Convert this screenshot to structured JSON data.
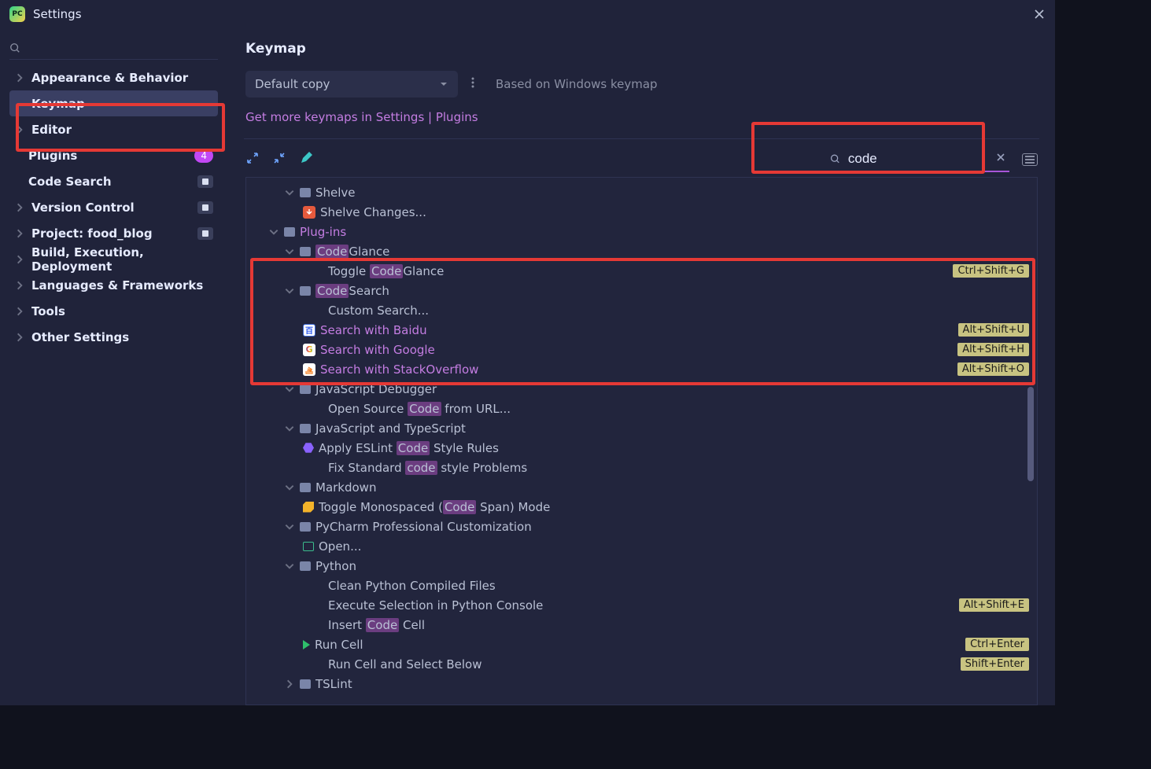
{
  "title": "Settings",
  "crumb": "Keymap",
  "select_value": "Default copy",
  "based_on": "Based on Windows keymap",
  "link_text": "Get more keymaps in Settings | Plugins",
  "search_value": "code",
  "sidebar": [
    {
      "label": "Appearance & Behavior",
      "chev": true
    },
    {
      "label": "Keymap",
      "chev": false,
      "selected": true
    },
    {
      "label": "Editor",
      "chev": true
    },
    {
      "label": "Plugins",
      "chev": false,
      "indent": true,
      "badge": "4"
    },
    {
      "label": "Code Search",
      "chev": false,
      "indent": true,
      "prof": true
    },
    {
      "label": "Version Control",
      "chev": true,
      "prof": true
    },
    {
      "label": "Project: food_blog",
      "chev": true,
      "prof": true
    },
    {
      "label": "Build, Execution, Deployment",
      "chev": true
    },
    {
      "label": "Languages & Frameworks",
      "chev": true
    },
    {
      "label": "Tools",
      "chev": true
    },
    {
      "label": "Other Settings",
      "chev": true
    }
  ],
  "tree": [
    {
      "lv": 2,
      "chev": "down",
      "folder": true,
      "txt": "Shelve"
    },
    {
      "lv": 3,
      "icon": "red",
      "txt": "Shelve Changes..."
    },
    {
      "lv": 1,
      "chev": "down",
      "folder": true,
      "link": true,
      "txt": "Plug-ins"
    },
    {
      "lv": 2,
      "chev": "down",
      "folder": true,
      "parts": [
        {
          "hl": "Code"
        },
        {
          "t": "Glance"
        }
      ]
    },
    {
      "lv": 4,
      "parts": [
        {
          "t": "Toggle "
        },
        {
          "hl": "Code"
        },
        {
          "t": "Glance"
        }
      ],
      "chip": "Ctrl+Shift+G"
    },
    {
      "lv": 2,
      "chev": "down",
      "folder": true,
      "parts": [
        {
          "hl": "Code"
        },
        {
          "t": "Search"
        }
      ]
    },
    {
      "lv": 4,
      "txt": "Custom Search..."
    },
    {
      "lv": 3,
      "icon": "baidu",
      "link": true,
      "txt": "Search with Baidu",
      "chip": "Alt+Shift+U"
    },
    {
      "lv": 3,
      "icon": "google",
      "link": true,
      "txt": "Search with Google",
      "chip": "Alt+Shift+H"
    },
    {
      "lv": 3,
      "icon": "so",
      "link": true,
      "txt": "Search with StackOverflow",
      "chip": "Alt+Shift+O"
    },
    {
      "lv": 2,
      "chev": "down",
      "folder": true,
      "txt": "JavaScript Debugger"
    },
    {
      "lv": 4,
      "parts": [
        {
          "t": "Open Source "
        },
        {
          "hl": "Code"
        },
        {
          "t": " from URL..."
        }
      ]
    },
    {
      "lv": 2,
      "chev": "down",
      "folder": true,
      "txt": "JavaScript and TypeScript"
    },
    {
      "lv": 3,
      "icon": "hex",
      "parts": [
        {
          "t": "Apply ESLint "
        },
        {
          "hl": "Code"
        },
        {
          "t": " Style Rules"
        }
      ]
    },
    {
      "lv": 4,
      "parts": [
        {
          "t": "Fix Standard "
        },
        {
          "hl": "code"
        },
        {
          "t": " style Problems"
        }
      ]
    },
    {
      "lv": 2,
      "chev": "down",
      "folder": true,
      "txt": "Markdown"
    },
    {
      "lv": 3,
      "icon": "tag",
      "parts": [
        {
          "t": "Toggle Monospaced ("
        },
        {
          "hl": "Code"
        },
        {
          "t": " Span) Mode"
        }
      ]
    },
    {
      "lv": 2,
      "chev": "down",
      "folder": true,
      "txt": "PyCharm Professional Customization"
    },
    {
      "lv": 3,
      "icon": "gfolder",
      "txt": "Open..."
    },
    {
      "lv": 2,
      "chev": "down",
      "folder": true,
      "txt": "Python"
    },
    {
      "lv": 4,
      "txt": "Clean Python Compiled Files"
    },
    {
      "lv": 4,
      "txt": "Execute Selection in Python Console",
      "chip": "Alt+Shift+E"
    },
    {
      "lv": 4,
      "parts": [
        {
          "t": "Insert "
        },
        {
          "hl": "Code"
        },
        {
          "t": " Cell"
        }
      ]
    },
    {
      "lv": 3,
      "icon": "play",
      "txt": "Run Cell",
      "chip": "Ctrl+Enter"
    },
    {
      "lv": 4,
      "txt": "Run Cell and Select Below",
      "chip": "Shift+Enter"
    },
    {
      "lv": 2,
      "chev": "right",
      "folder": true,
      "txt": "TSLint"
    }
  ]
}
